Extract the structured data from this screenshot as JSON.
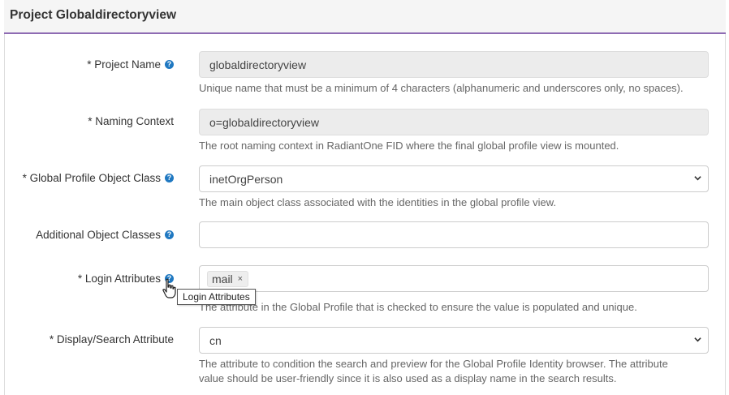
{
  "header": {
    "title": "Project Globaldirectoryview"
  },
  "fields": {
    "project_name": {
      "label": "* Project Name",
      "value": "globaldirectoryview",
      "help": "Unique name that must be a minimum of 4 characters (alphanumeric and underscores only, no spaces)."
    },
    "naming_context": {
      "label": "* Naming Context",
      "value": "o=globaldirectoryview",
      "help": "The root naming context in RadiantOne FID where the final global profile view is mounted."
    },
    "object_class": {
      "label": "* Global Profile Object Class",
      "value": "inetOrgPerson",
      "help": "The main object class associated with the identities in the global profile view."
    },
    "additional_classes": {
      "label": "Additional Object Classes",
      "value": ""
    },
    "login_attributes": {
      "label": "* Login Attributes",
      "tags": [
        "mail"
      ],
      "tag_remove": "×",
      "tooltip": "Login Attributes",
      "help": "The attribute in the Global Profile that is checked to ensure the value is populated and unique."
    },
    "display_attribute": {
      "label": "* Display/Search Attribute",
      "value": "cn",
      "help_line1": "The attribute to condition the search and preview for the Global Profile Identity browser. The attribute",
      "help_line2": "value should be user-friendly since it is also used as a display name in the search results."
    }
  },
  "icons": {
    "help": "question-circle-icon",
    "chevron": "chevron-down-icon",
    "cursor": "hand-pointer-icon"
  },
  "colors": {
    "accent": "#8e6bb3",
    "help_icon": "#1f78c1"
  }
}
